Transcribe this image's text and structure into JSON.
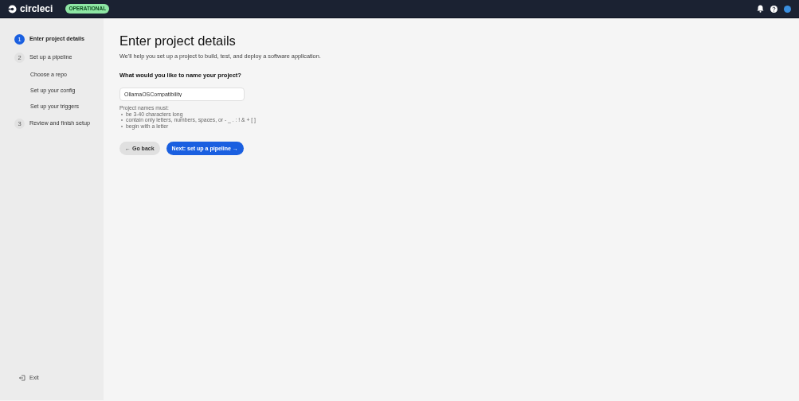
{
  "header": {
    "logo_text": "circleci",
    "status_badge": "OPERATIONAL"
  },
  "steps": [
    {
      "number": "1",
      "label": "Enter project details",
      "selected": true
    },
    {
      "number": "2",
      "label": "Set up a pipeline",
      "selected": false,
      "children": [
        {
          "label": "Choose a repo"
        },
        {
          "label": "Set up your config"
        },
        {
          "label": "Set up your triggers"
        }
      ]
    },
    {
      "number": "3",
      "label": "Review and finish setup",
      "selected": false
    }
  ],
  "exit": "Exit",
  "title": "Enter project details",
  "subtitle": "We'll help you set up a project to build, test, and deploy a software application.",
  "field_label": "What would you like to name your project?",
  "field_value": "OllamaOSCompatibility",
  "rules_heading": "Project names must:",
  "rules": [
    "be 3-40 characters long",
    "contain only letters, numbers, spaces, or - _ . : ! & + [ ]",
    "begin with a letter"
  ],
  "buttons": [
    {
      "label": "← Go back",
      "kind": "secondary"
    },
    {
      "label": "Next: set up a pipeline →",
      "kind": "primary"
    }
  ]
}
